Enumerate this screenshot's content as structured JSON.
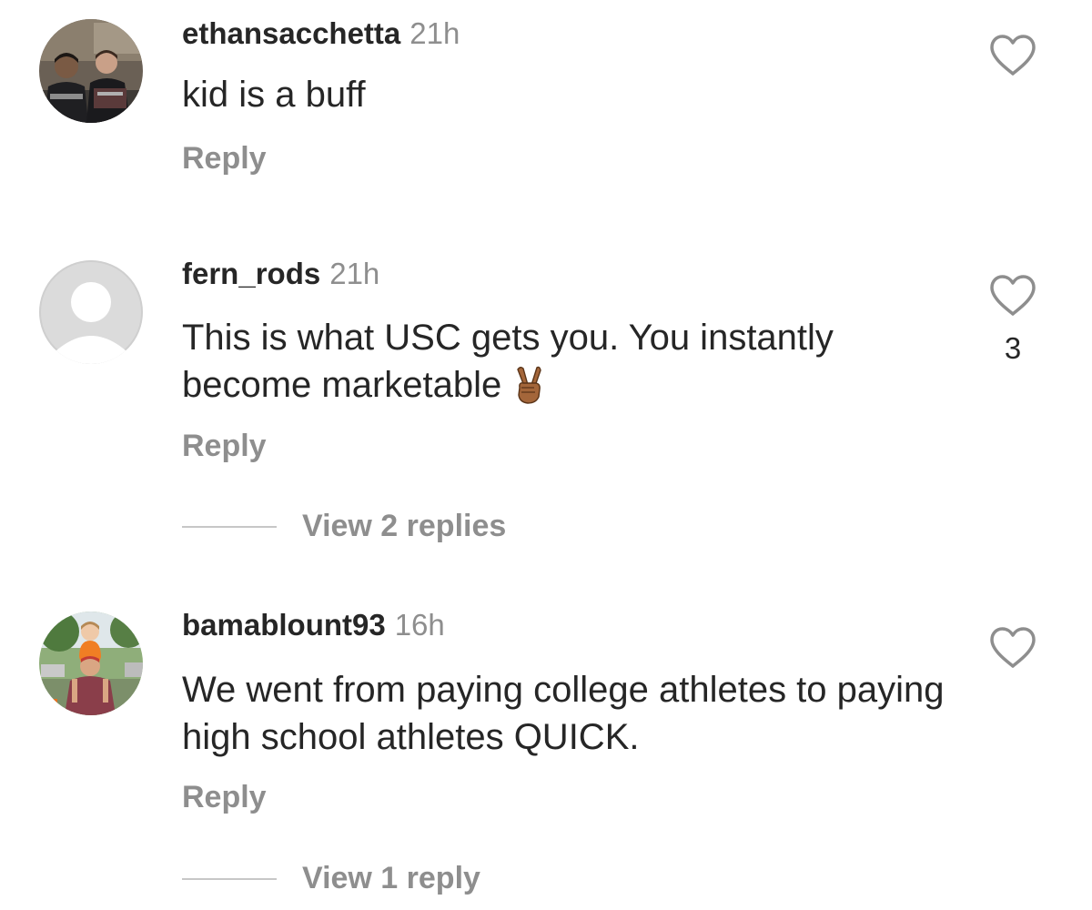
{
  "comments": [
    {
      "username": "ethansacchetta",
      "time": "21h",
      "text": "kid is a buff",
      "emoji": "",
      "reply_label": "Reply",
      "like_count": "",
      "view_replies": ""
    },
    {
      "username": "fern_rods",
      "time": "21h",
      "text": "This is what USC gets you. You instantly become marketable",
      "emoji": "✌🏽",
      "reply_label": "Reply",
      "like_count": "3",
      "view_replies": "View 2 replies"
    },
    {
      "username": "bamablount93",
      "time": "16h",
      "text": "We went from paying college athletes to paying high school athletes QUICK.",
      "emoji": "",
      "reply_label": "Reply",
      "like_count": "",
      "view_replies": "View 1 reply"
    }
  ],
  "icons": {
    "like": "heart-outline-icon",
    "default_avatar": "default-avatar-icon"
  },
  "colors": {
    "text_primary": "#262626",
    "text_secondary": "#8e8e8e",
    "divider": "#c7c7c7",
    "default_avatar_bg": "#dbdbdb"
  }
}
